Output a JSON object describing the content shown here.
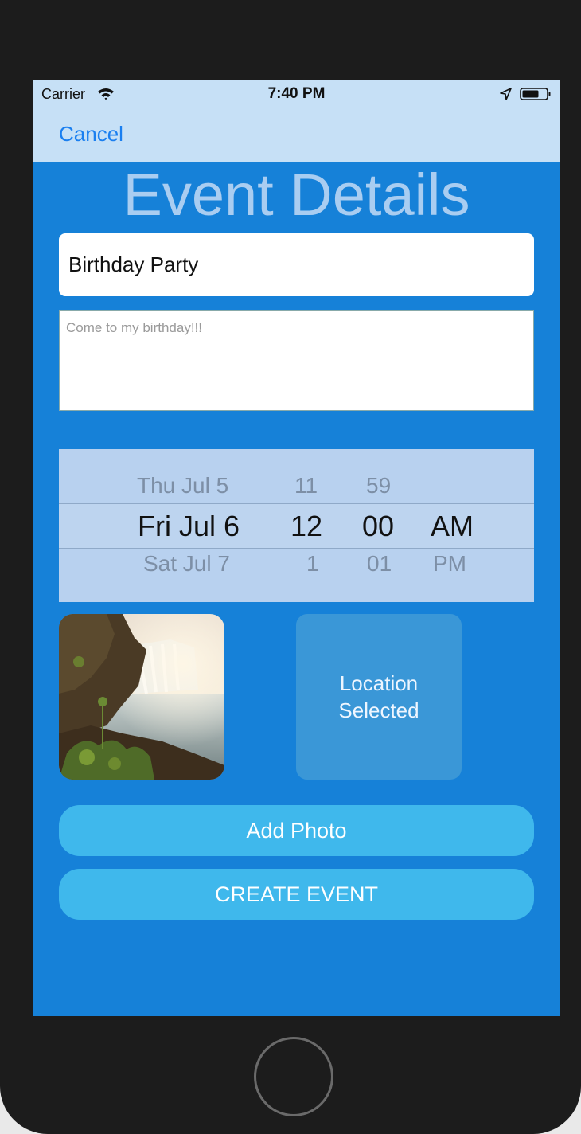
{
  "status_bar": {
    "carrier": "Carrier",
    "time": "7:40 PM"
  },
  "navbar": {
    "cancel_label": "Cancel"
  },
  "page_title": "Event Details",
  "form": {
    "event_name_value": "Birthday Party",
    "description_text": "Come to my birthday!!!"
  },
  "date_picker": {
    "dates": [
      "Thu Jul 5",
      "Fri Jul 6",
      "Sat Jul 7"
    ],
    "hours": [
      "11",
      "12",
      "1"
    ],
    "minutes": [
      "59",
      "00",
      "01"
    ],
    "periods": [
      "AM",
      "PM"
    ]
  },
  "location_label": "Location Selected",
  "buttons": {
    "add_photo": "Add Photo",
    "create_event": "CREATE EVENT"
  },
  "colors": {
    "background": "#1681d8",
    "navbar": "#c6e0f6",
    "button": "#3fb8ec",
    "accent": "#1a7ff0"
  }
}
